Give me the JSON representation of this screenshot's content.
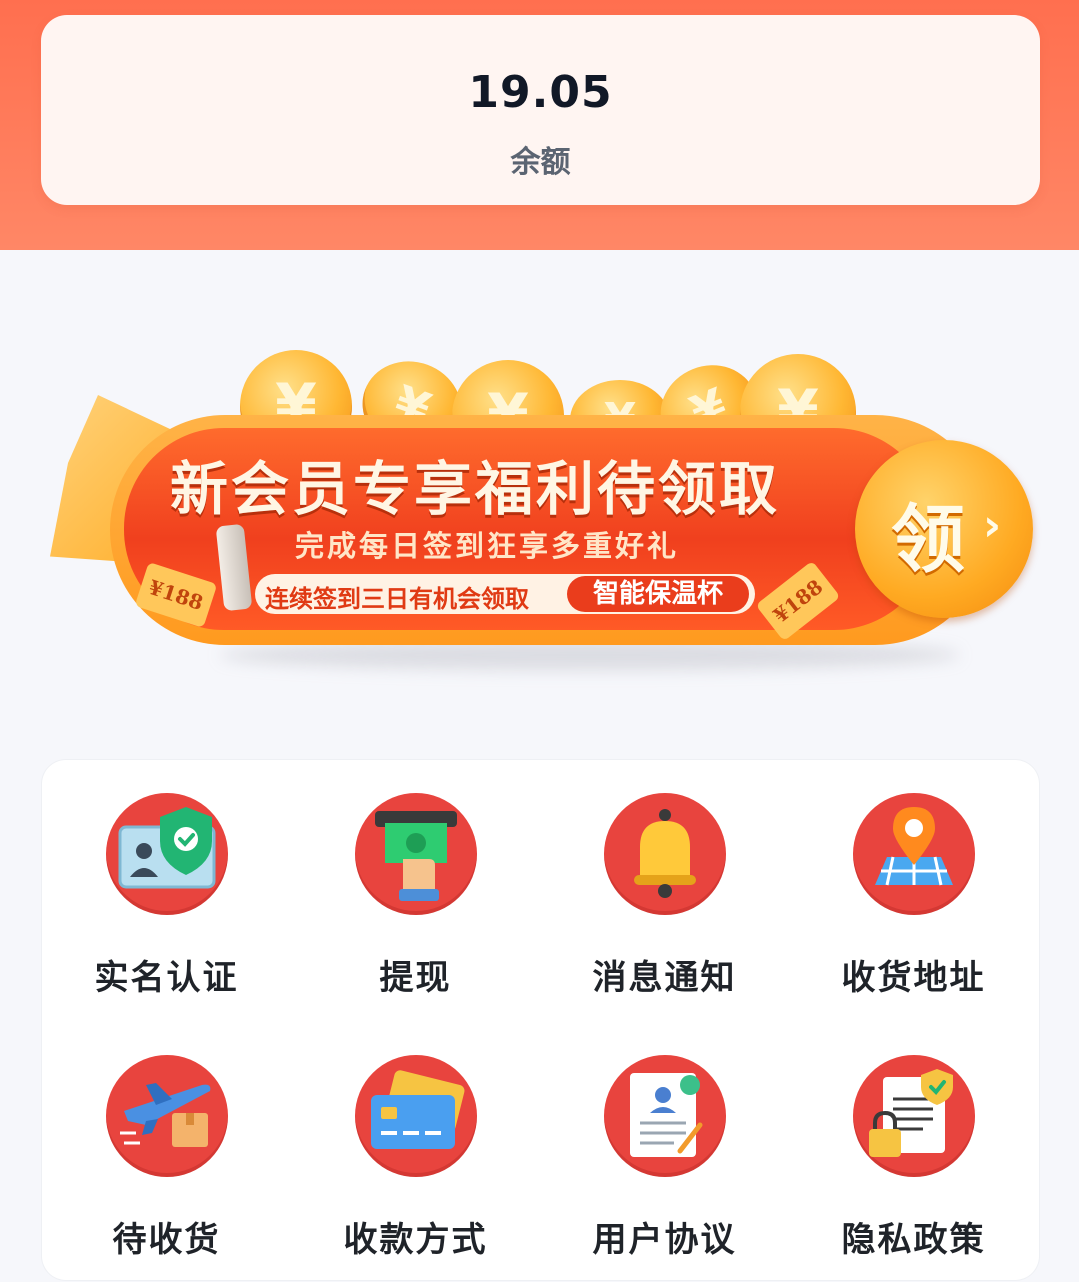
{
  "balance": {
    "amount": "19.05",
    "label": "余额"
  },
  "promo_banner": {
    "title": "新会员专享福利待领取",
    "subtitle": "完成每日签到狂享多重好礼",
    "pill_text": "连续签到三日有机会领取",
    "pill_tag": "智能保温杯",
    "ticket_value": "¥188",
    "claim_label": "领",
    "claim_arrow": "›",
    "coin_symbol": "¥"
  },
  "menu": {
    "items": [
      {
        "label": "实名认证",
        "icon": "id-card-shield-icon"
      },
      {
        "label": "提现",
        "icon": "cash-withdraw-icon"
      },
      {
        "label": "消息通知",
        "icon": "bell-icon"
      },
      {
        "label": "收货地址",
        "icon": "map-pin-icon"
      },
      {
        "label": "待收货",
        "icon": "airplane-package-icon"
      },
      {
        "label": "收款方式",
        "icon": "credit-card-icon"
      },
      {
        "label": "用户协议",
        "icon": "contract-document-icon"
      },
      {
        "label": "隐私政策",
        "icon": "privacy-lock-document-icon"
      }
    ]
  },
  "colors": {
    "header": "#ff7352",
    "icon_circle": "#e8443e",
    "banner_red": "#f0401e",
    "banner_gold": "#ffaa22"
  }
}
